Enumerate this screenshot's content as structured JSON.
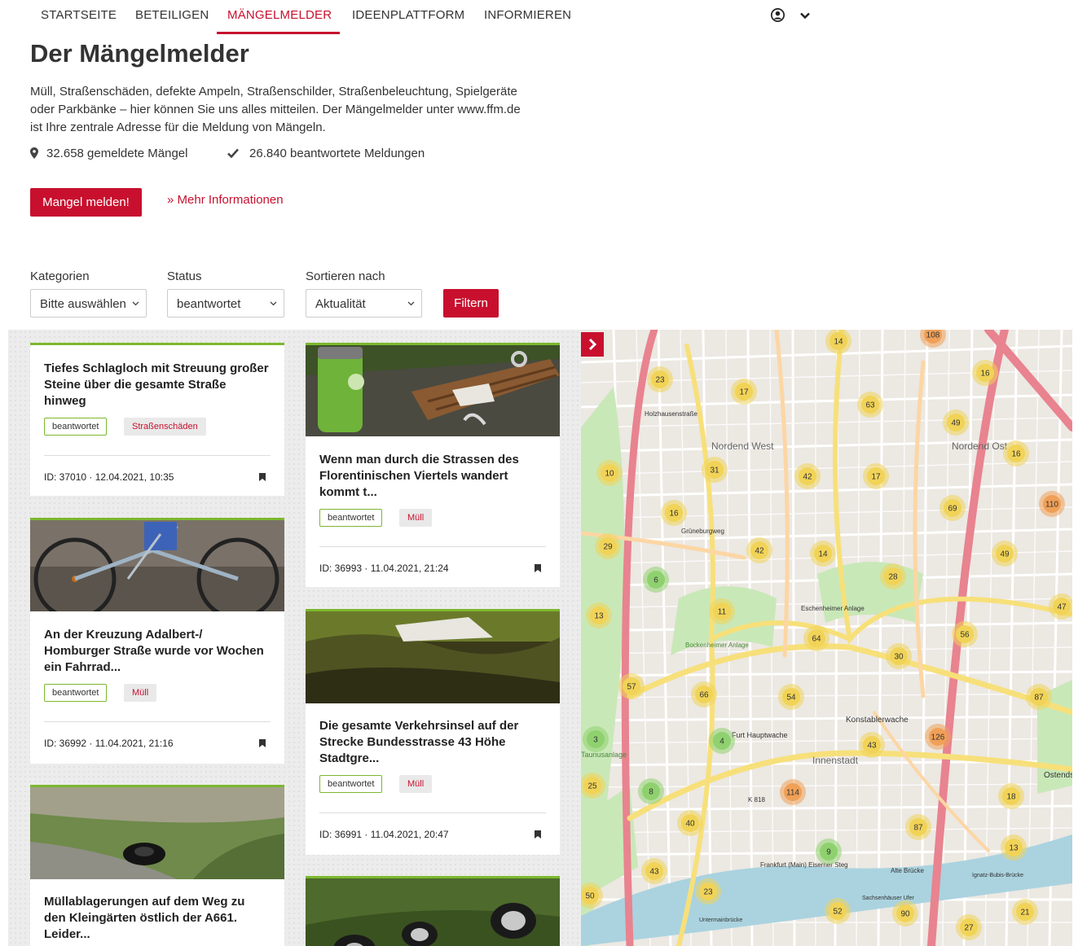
{
  "nav": {
    "items": [
      "STARTSEITE",
      "BETEILIGEN",
      "MÄNGELMELDER",
      "IDEENPLATTFORM",
      "INFORMIEREN"
    ],
    "active_index": 2,
    "accent_color": "#c8102e"
  },
  "header": {
    "title": "Der Mängelmelder",
    "intro_lines": [
      "Müll, Straßenschäden, defekte Ampeln, Straßenschilder, Straßenbeleuchtung, Spielgeräte",
      "oder Parkbänke – hier können Sie uns alles mitteilen. Der Mängelmelder unter www.ffm.de",
      "ist Ihre zentrale Adresse für die Meldung von Mängeln."
    ],
    "stat_reported": "32.658 gemeldete Mängel",
    "stat_answered": "26.840 beantwortete Meldungen",
    "report_button": "Mangel melden!",
    "more_link": "» Mehr Informationen"
  },
  "filters": {
    "category_label": "Kategorien",
    "category_value": "Bitte auswählen",
    "status_label": "Status",
    "status_value": "beantwortet",
    "sort_label": "Sortieren nach",
    "sort_value": "Aktualität",
    "filter_button": "Filtern"
  },
  "cards": [
    {
      "title": [
        "Tiefes Schlagloch mit Streuung großer",
        "Steine über die gesamte Straße",
        "hinweg"
      ],
      "status": "beantwortet",
      "category": "Straßenschäden",
      "meta": "ID: 37010 · 12.04.2021, 10:35",
      "photo": "none"
    },
    {
      "title": [
        "Wenn man durch die Strassen des",
        "Florentinischen Viertels wandert",
        "kommt t..."
      ],
      "status": "beantwortet",
      "category": "Müll",
      "meta": "ID: 36993 · 11.04.2021, 21:24",
      "photo": "bench-with-trash-can"
    },
    {
      "title": [
        "An der Kreuzung Adalbert-/",
        "Homburger Straße wurde vor Wochen",
        "ein Fahrrad..."
      ],
      "status": "beantwortet",
      "category": "Müll",
      "meta": "ID: 36992 · 11.04.2021, 21:16",
      "photo": "abandoned-bicycle"
    },
    {
      "title": [
        "Die gesamte Verkehrsinsel auf der",
        "Strecke Bundesstrasse 43 Höhe",
        "Stadtgre..."
      ],
      "status": "beantwortet",
      "category": "Müll",
      "meta": "ID: 36991 · 11.04.2021, 20:47",
      "photo": "littered-traffic-island"
    },
    {
      "title": [
        "Müllablagerungen auf dem Weg zu",
        "den Kleingärten östlich der A661.",
        "Leider..."
      ],
      "photo": "tire-on-grass"
    },
    {
      "photo": "dumped-tires"
    }
  ],
  "map": {
    "district_labels": [
      "Nordend West",
      "Nordend Ost",
      "Innenstadt",
      "Konstablerwache",
      "Ostendstr",
      "Holzhausenstraße",
      "Grüneburgweg",
      "Frankfurt (Main) Eiserner Steg",
      "Alte Brücke",
      "Furt Hauptwache",
      "Bockenheimer Anlage",
      "Eschenheimer Anlage",
      "Untermainbrücke",
      "Sachsenhäuser Ufer",
      "Ignatz-Bubis-Brücke",
      "Taunusanlage",
      "K 818"
    ],
    "cluster_counts": [
      23,
      17,
      14,
      108,
      16,
      63,
      49,
      31,
      42,
      17,
      10,
      16,
      16,
      69,
      110,
      29,
      42,
      14,
      49,
      6,
      28,
      13,
      11,
      64,
      47,
      56,
      30,
      57,
      66,
      54,
      87,
      3,
      4,
      43,
      126,
      25,
      8,
      114,
      18,
      40,
      87,
      13,
      9,
      43,
      50,
      23,
      52,
      90,
      21,
      27
    ],
    "toggle_icon": "chevron-right-icon"
  }
}
